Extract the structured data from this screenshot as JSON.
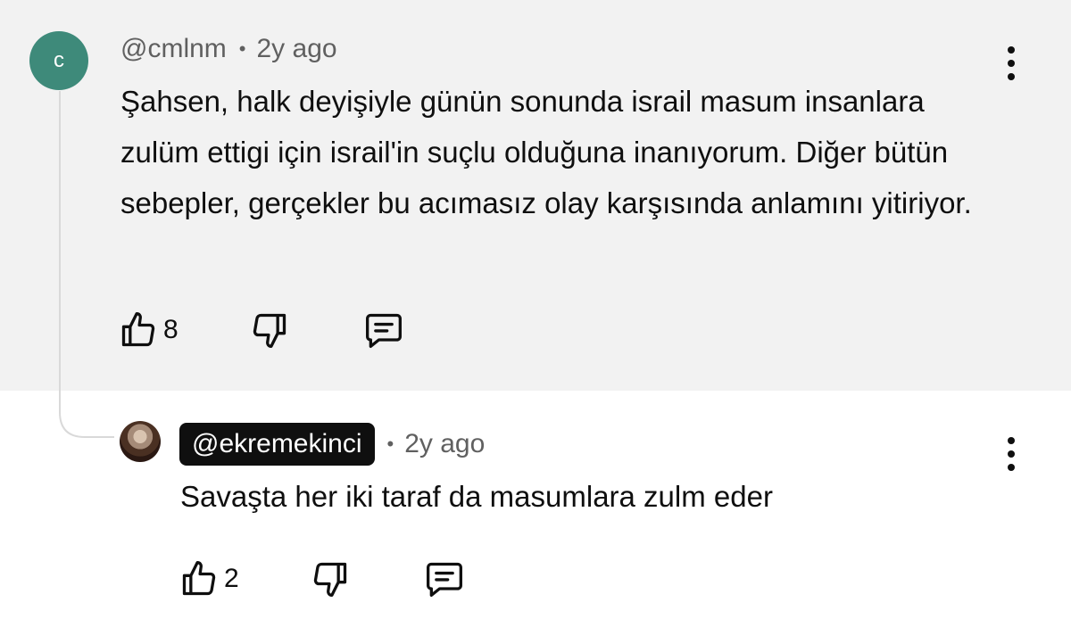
{
  "comment": {
    "avatar_letter": "c",
    "avatar_color": "#3e8a7a",
    "handle": "@cmlnm",
    "separator": "•",
    "time": "2y ago",
    "text": "Şahsen, halk deyişiyle günün sonunda israil masum insanlara zulüm ettigi için israil'in suçlu olduğuna inanıyorum. Diğer bütün sebepler, gerçekler bu acımasız olay karşısında anlamını yitiriyor.",
    "likes": "8",
    "icons": {
      "like": "thumbs-up-icon",
      "dislike": "thumbs-down-icon",
      "reply": "comment-icon",
      "more": "more-vertical-icon"
    }
  },
  "reply": {
    "handle": "@ekremekinci",
    "separator": "•",
    "time": "2y ago",
    "text": "Savaşta her iki taraf da masumlara zulm eder",
    "likes": "2"
  },
  "colors": {
    "comment_background": "#f2f2f2",
    "handle_badge": "#0f0f0f"
  }
}
